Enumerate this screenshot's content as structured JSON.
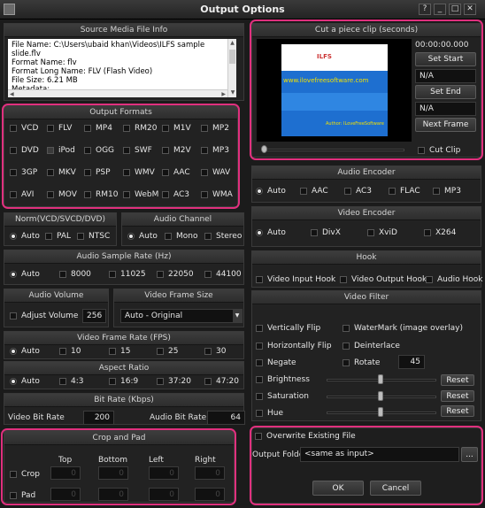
{
  "window": {
    "title": "Output Options"
  },
  "source": {
    "header": "Source Media File Info",
    "lines": [
      "File Name: C:\\Users\\ubaid khan\\Videos\\ILFS sample slide.flv",
      "Format Name: flv",
      "Format Long Name: FLV (Flash Video)",
      "File Size: 6.21 MB",
      "Metadata:"
    ]
  },
  "clip": {
    "header": "Cut a piece clip (seconds)",
    "time": "00:00:00.000",
    "set_start": "Set Start",
    "start_value": "N/A",
    "set_end": "Set End",
    "end_value": "N/A",
    "next_frame": "Next Frame",
    "cut_clip": "Cut Clip",
    "preview_logo": "ILFS",
    "preview_url": "www.ilovefreesoftware.com",
    "preview_author": "Author: ILoveFreeSoftware"
  },
  "formats": {
    "header": "Output Formats",
    "items": [
      "VCD",
      "FLV",
      "MP4",
      "RM20",
      "M1V",
      "MP2",
      "DVD",
      "iPod",
      "OGG",
      "SWF",
      "M2V",
      "MP3",
      "3GP",
      "MKV",
      "PSP",
      "WMV",
      "AAC",
      "WAV",
      "AVI",
      "MOV",
      "RM10",
      "WebM",
      "AC3",
      "WMA"
    ]
  },
  "norm": {
    "header": "Norm(VCD/SVCD/DVD)",
    "items": [
      "Auto",
      "PAL",
      "NTSC"
    ]
  },
  "audio_channel": {
    "header": "Audio Channel",
    "items": [
      "Auto",
      "Mono",
      "Stereo"
    ]
  },
  "audio_rate": {
    "header": "Audio Sample Rate (Hz)",
    "items": [
      "Auto",
      "8000",
      "11025",
      "22050",
      "44100"
    ]
  },
  "audio_volume": {
    "header": "Audio Volume",
    "label": "Adjust Volume",
    "value": "256"
  },
  "frame_size": {
    "header": "Video Frame Size",
    "value": "Auto - Original"
  },
  "fps": {
    "header": "Video Frame Rate (FPS)",
    "items": [
      "Auto",
      "10",
      "15",
      "25",
      "30"
    ]
  },
  "aspect": {
    "header": "Aspect Ratio",
    "items": [
      "Auto",
      "4:3",
      "16:9",
      "37:20",
      "47:20"
    ]
  },
  "bitrate": {
    "header": "Bit Rate (Kbps)",
    "video_label": "Video Bit Rate",
    "video_value": "200",
    "audio_label": "Audio Bit Rate",
    "audio_value": "64"
  },
  "crop": {
    "header": "Crop and Pad",
    "cols": [
      "Top",
      "Bottom",
      "Left",
      "Right"
    ],
    "crop_label": "Crop",
    "pad_label": "Pad",
    "crop_values": [
      "0",
      "0",
      "0",
      "0"
    ],
    "pad_values": [
      "0",
      "0",
      "0",
      "0"
    ]
  },
  "audio_encoder": {
    "header": "Audio Encoder",
    "items": [
      "Auto",
      "AAC",
      "AC3",
      "FLAC",
      "MP3"
    ]
  },
  "video_encoder": {
    "header": "Video Encoder",
    "items": [
      "Auto",
      "DivX",
      "XviD",
      "X264"
    ]
  },
  "hook": {
    "header": "Hook",
    "items": [
      "Video Input Hook",
      "Video Output Hook",
      "Audio Hook"
    ]
  },
  "filter": {
    "header": "Video Filter",
    "vflip": "Vertically Flip",
    "hflip": "Horizontally Flip",
    "negate": "Negate",
    "watermark": "WaterMark (image overlay)",
    "deinterlace": "Deinterlace",
    "rotate": "Rotate",
    "rotate_value": "45",
    "brightness": "Brightness",
    "saturation": "Saturation",
    "hue": "Hue",
    "reset": "Reset"
  },
  "output": {
    "overwrite": "Overwrite Existing File",
    "folder_label": "Output Folder",
    "folder_value": "<same as input>",
    "browse": "...",
    "ok": "OK",
    "cancel": "Cancel"
  }
}
